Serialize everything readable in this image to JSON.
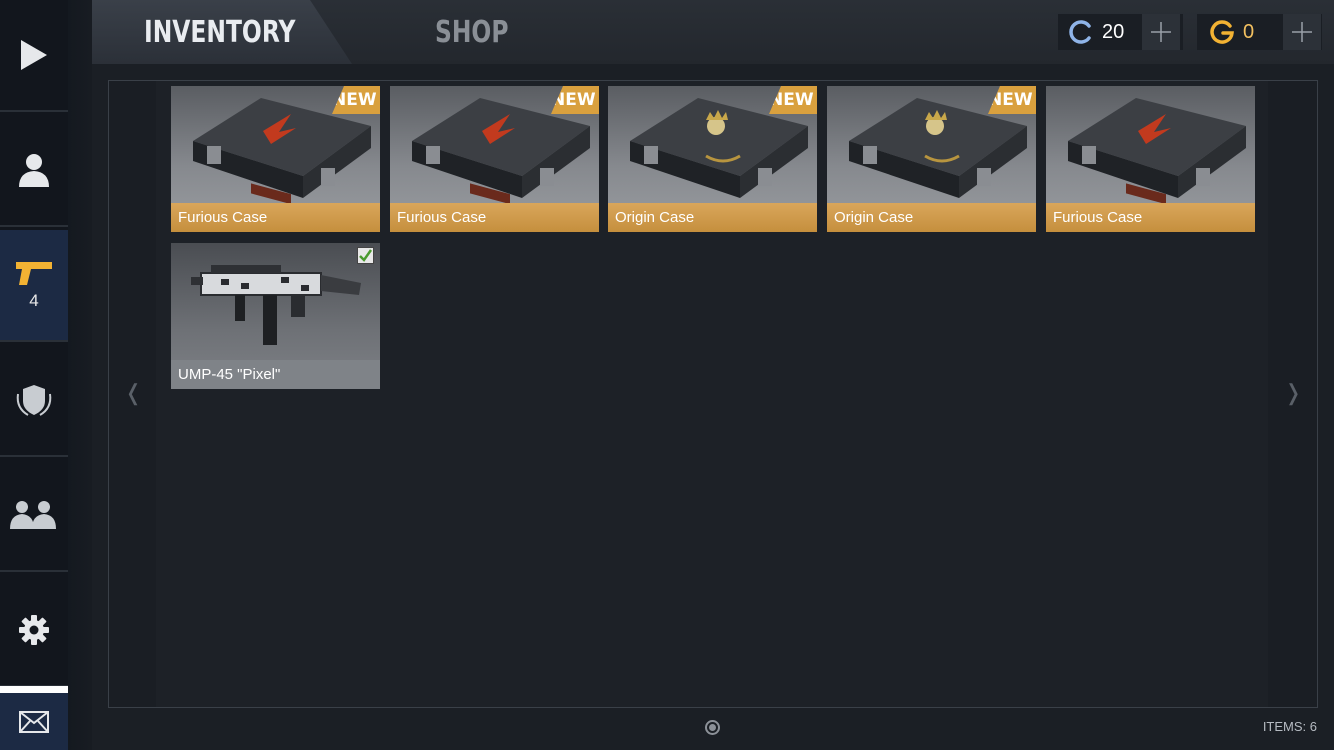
{
  "tabs": {
    "inventory": "INVENTORY",
    "shop": "SHOP"
  },
  "sidebar": {
    "items": [
      {
        "icon": "play-icon"
      },
      {
        "icon": "profile-icon"
      },
      {
        "icon": "pistol-icon",
        "badge": "4"
      },
      {
        "icon": "shield-icon"
      },
      {
        "icon": "friends-icon"
      },
      {
        "icon": "gear-icon"
      }
    ],
    "mail_icon": "mail-icon"
  },
  "currency": {
    "credits": {
      "icon": "credits-c-icon",
      "amount": "20",
      "plus": "+"
    },
    "gold": {
      "icon": "gold-g-icon",
      "amount": "0",
      "plus": "+"
    }
  },
  "inventory": {
    "items": [
      {
        "name": "Furious Case",
        "tag": "NEW",
        "kind": "furious"
      },
      {
        "name": "Furious Case",
        "tag": "NEW",
        "kind": "furious"
      },
      {
        "name": "Origin Case",
        "tag": "NEW",
        "kind": "origin"
      },
      {
        "name": "Origin Case",
        "tag": "NEW",
        "kind": "origin"
      },
      {
        "name": "Furious Case",
        "tag": "",
        "kind": "furious"
      },
      {
        "name": "UMP-45 \"Pixel\"",
        "tag": "",
        "kind": "weapon",
        "equipped": true
      }
    ],
    "nav_left": "❬",
    "nav_right": "❭"
  },
  "footer": {
    "items_count": "ITEMS: 6"
  },
  "colors": {
    "accent_gold": "#d9a03e",
    "active_sidebar": "#1c2a44",
    "credits_blue": "#8fb4e8",
    "gold_yellow": "#f2b233"
  }
}
